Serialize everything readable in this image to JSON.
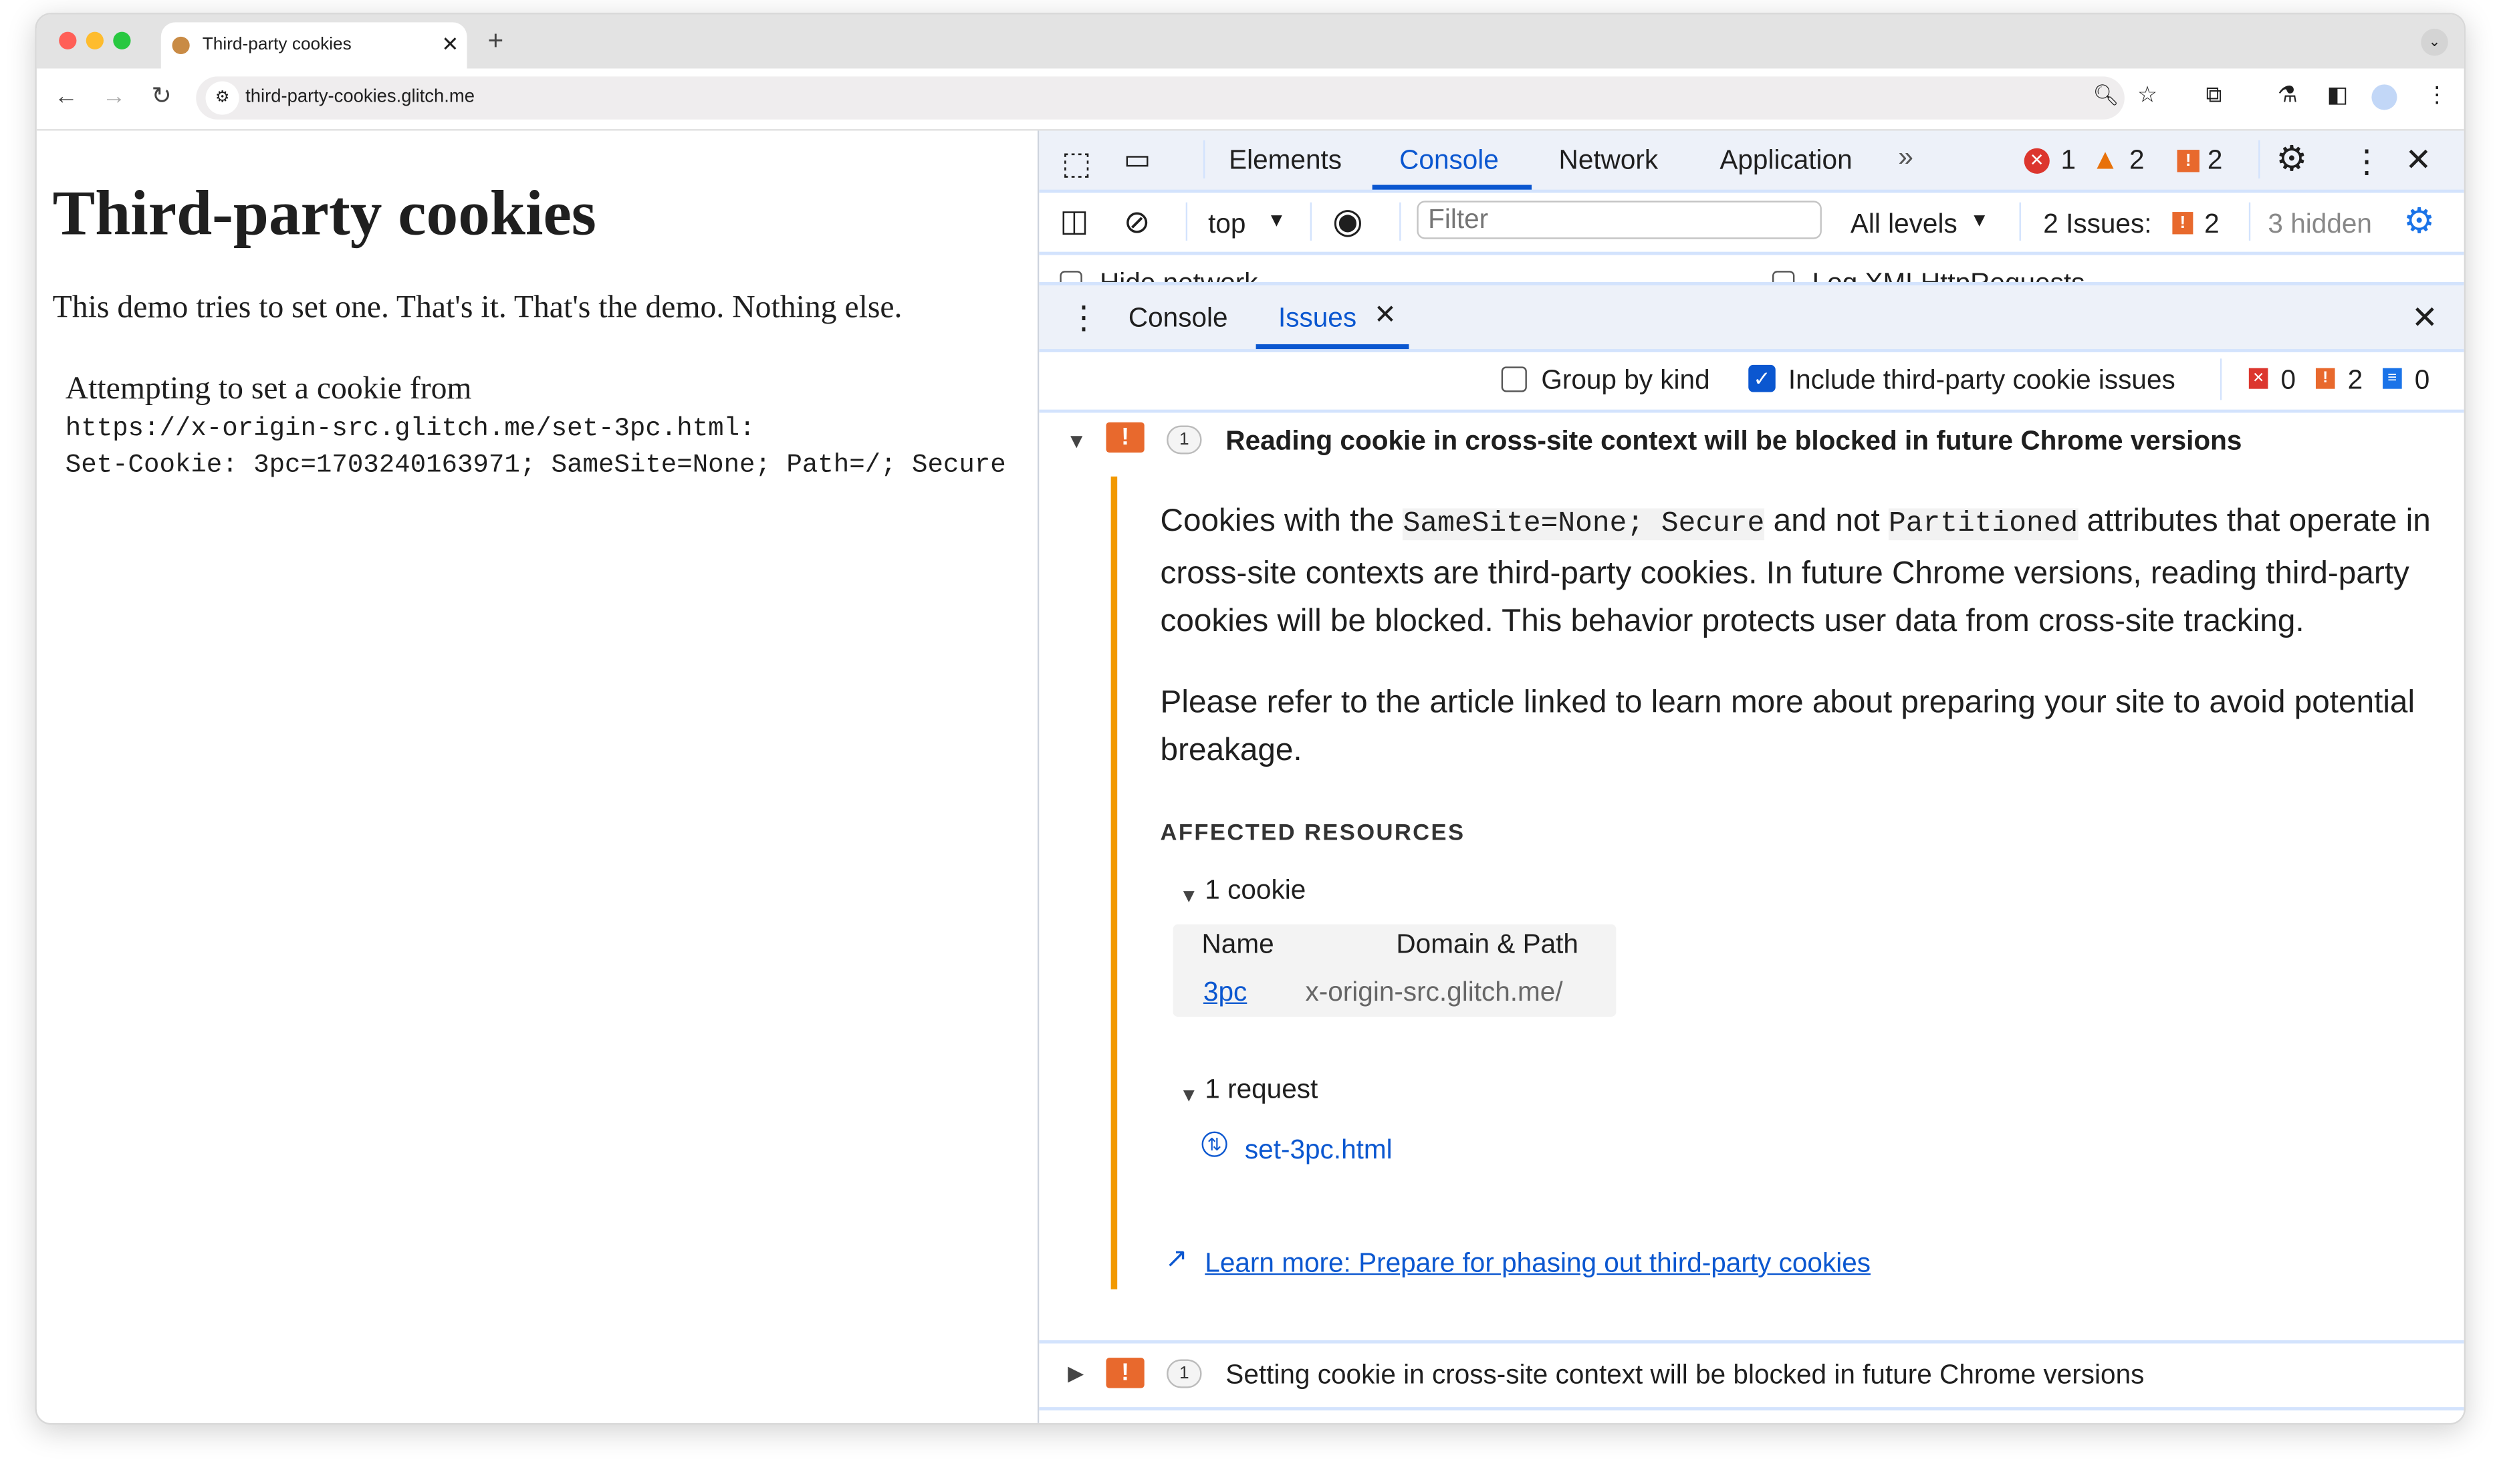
{
  "browser": {
    "tab_title": "Third-party cookies",
    "url": "third-party-cookies.glitch.me",
    "new_tab": "+"
  },
  "page": {
    "heading": "Third-party cookies",
    "intro": "This demo tries to set one. That's it. That's the demo. Nothing else.",
    "attempt": "Attempting to set a cookie from",
    "source_url": "https://x-origin-src.glitch.me/set-3pc.html:",
    "set_cookie": "Set-Cookie: 3pc=1703240163971; SameSite=None; Path=/; Secure"
  },
  "devtools": {
    "tabs": [
      "Elements",
      "Console",
      "Network",
      "Application"
    ],
    "active_tab": "Console",
    "counts": {
      "errors": "1",
      "warnings": "2",
      "issues": "2"
    },
    "console_toolbar": {
      "context": "top",
      "filter_placeholder": "Filter",
      "levels": "All levels",
      "issues_label": "2 Issues:",
      "issues_count": "2",
      "hidden": "3 hidden"
    },
    "settings_row": {
      "hide_network": "Hide network",
      "log_xhr": "Log XMLHttpRequests"
    },
    "drawer": {
      "tabs": [
        "Console",
        "Issues"
      ],
      "active": "Issues"
    },
    "issues_toolbar": {
      "group_by_kind": "Group by kind",
      "group_by_kind_checked": false,
      "include_3pc": "Include third-party cookie issues",
      "include_3pc_checked": true,
      "error_count": "0",
      "warning_count": "2",
      "info_count": "0"
    },
    "issues": [
      {
        "count": "1",
        "title": "Reading cookie in cross-site context will be blocked in future Chrome versions",
        "expanded": true,
        "desc_1": "Cookies with the ",
        "code_1": "SameSite=None; Secure",
        "desc_2": " and not ",
        "code_2": "Partitioned",
        "desc_3": " attributes that operate in cross-site contexts are third-party cookies. In future Chrome versions, reading third-party cookies will be blocked. This behavior protects user data from cross-site tracking.",
        "desc_para2": "Please refer to the article linked to learn more about preparing your site to avoid potential breakage.",
        "affected_heading": "AFFECTED RESOURCES",
        "cookie_group": "1 cookie",
        "col_name": "Name",
        "col_domain": "Domain & Path",
        "cookie_name": "3pc",
        "cookie_domain": "x-origin-src.glitch.me/",
        "request_group": "1 request",
        "request_name": "set-3pc.html",
        "learn_more": "Learn more: Prepare for phasing out third-party cookies"
      },
      {
        "count": "1",
        "title": "Setting cookie in cross-site context will be blocked in future Chrome versions",
        "expanded": false
      }
    ]
  },
  "colors": {
    "accent": "#0b57d0",
    "issue_orange": "#e8692d",
    "error_red": "#dc362e",
    "warn_orange": "#e8710a",
    "issue_border": "#f29900"
  }
}
